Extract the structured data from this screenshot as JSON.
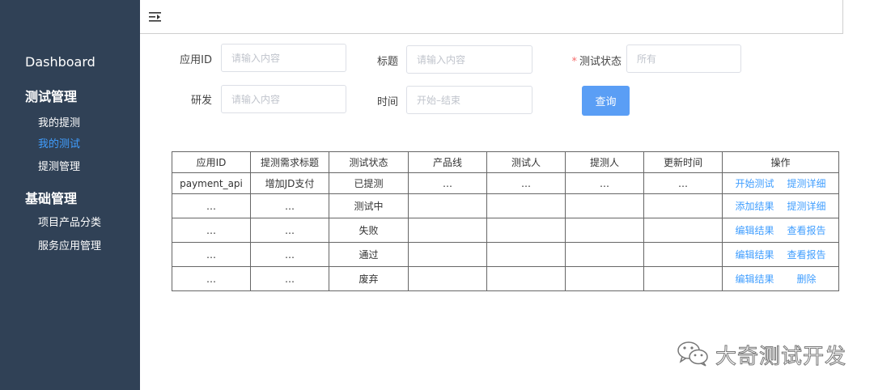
{
  "sidebar": {
    "dashboard": "Dashboard",
    "groups": [
      {
        "title": "测试管理",
        "items": [
          "我的提测",
          "我的测试",
          "提测管理"
        ]
      },
      {
        "title": "基础管理",
        "items": [
          "项目产品分类",
          "服务应用管理"
        ]
      }
    ],
    "active_item": "我的测试"
  },
  "header": {
    "toggle_icon": "menu-fold-icon"
  },
  "filters": {
    "app_id": {
      "label": "应用ID",
      "placeholder": "请输入内容"
    },
    "title": {
      "label": "标题",
      "placeholder": "请输入内容"
    },
    "status": {
      "required_mark": "*",
      "label": "测试状态",
      "placeholder": "所有"
    },
    "developer": {
      "label": "研发",
      "placeholder": "请输入内容"
    },
    "time": {
      "label": "时间",
      "placeholder": "开始–结束"
    },
    "query_button": "查询"
  },
  "table": {
    "headers": [
      "应用ID",
      "提测需求标题",
      "测试状态",
      "产品线",
      "测试人",
      "提测人",
      "更新时间",
      "操作"
    ],
    "rows": [
      {
        "cells": [
          "payment_api",
          "增加JD支付",
          "已提测",
          "…",
          "…",
          "…",
          "…"
        ],
        "actions": [
          "开始测试",
          "提测详细"
        ]
      },
      {
        "cells": [
          "…",
          "…",
          "测试中",
          "",
          "",
          "",
          ""
        ],
        "actions": [
          "添加结果",
          "提测详细"
        ]
      },
      {
        "cells": [
          "…",
          "…",
          "失败",
          "",
          "",
          "",
          ""
        ],
        "actions": [
          "编辑结果",
          "查看报告"
        ]
      },
      {
        "cells": [
          "…",
          "…",
          "通过",
          "",
          "",
          "",
          ""
        ],
        "actions": [
          "编辑结果",
          "查看报告"
        ]
      },
      {
        "cells": [
          "…",
          "…",
          "废弃",
          "",
          "",
          "",
          ""
        ],
        "actions": [
          "编辑结果",
          "删除"
        ]
      }
    ]
  },
  "watermark": {
    "text": "大奇测试开发",
    "icon": "wechat-icon"
  },
  "colors": {
    "sidebar_bg": "#304156",
    "active": "#409eff",
    "button": "#5a9ef5",
    "required": "#f56c6c"
  }
}
